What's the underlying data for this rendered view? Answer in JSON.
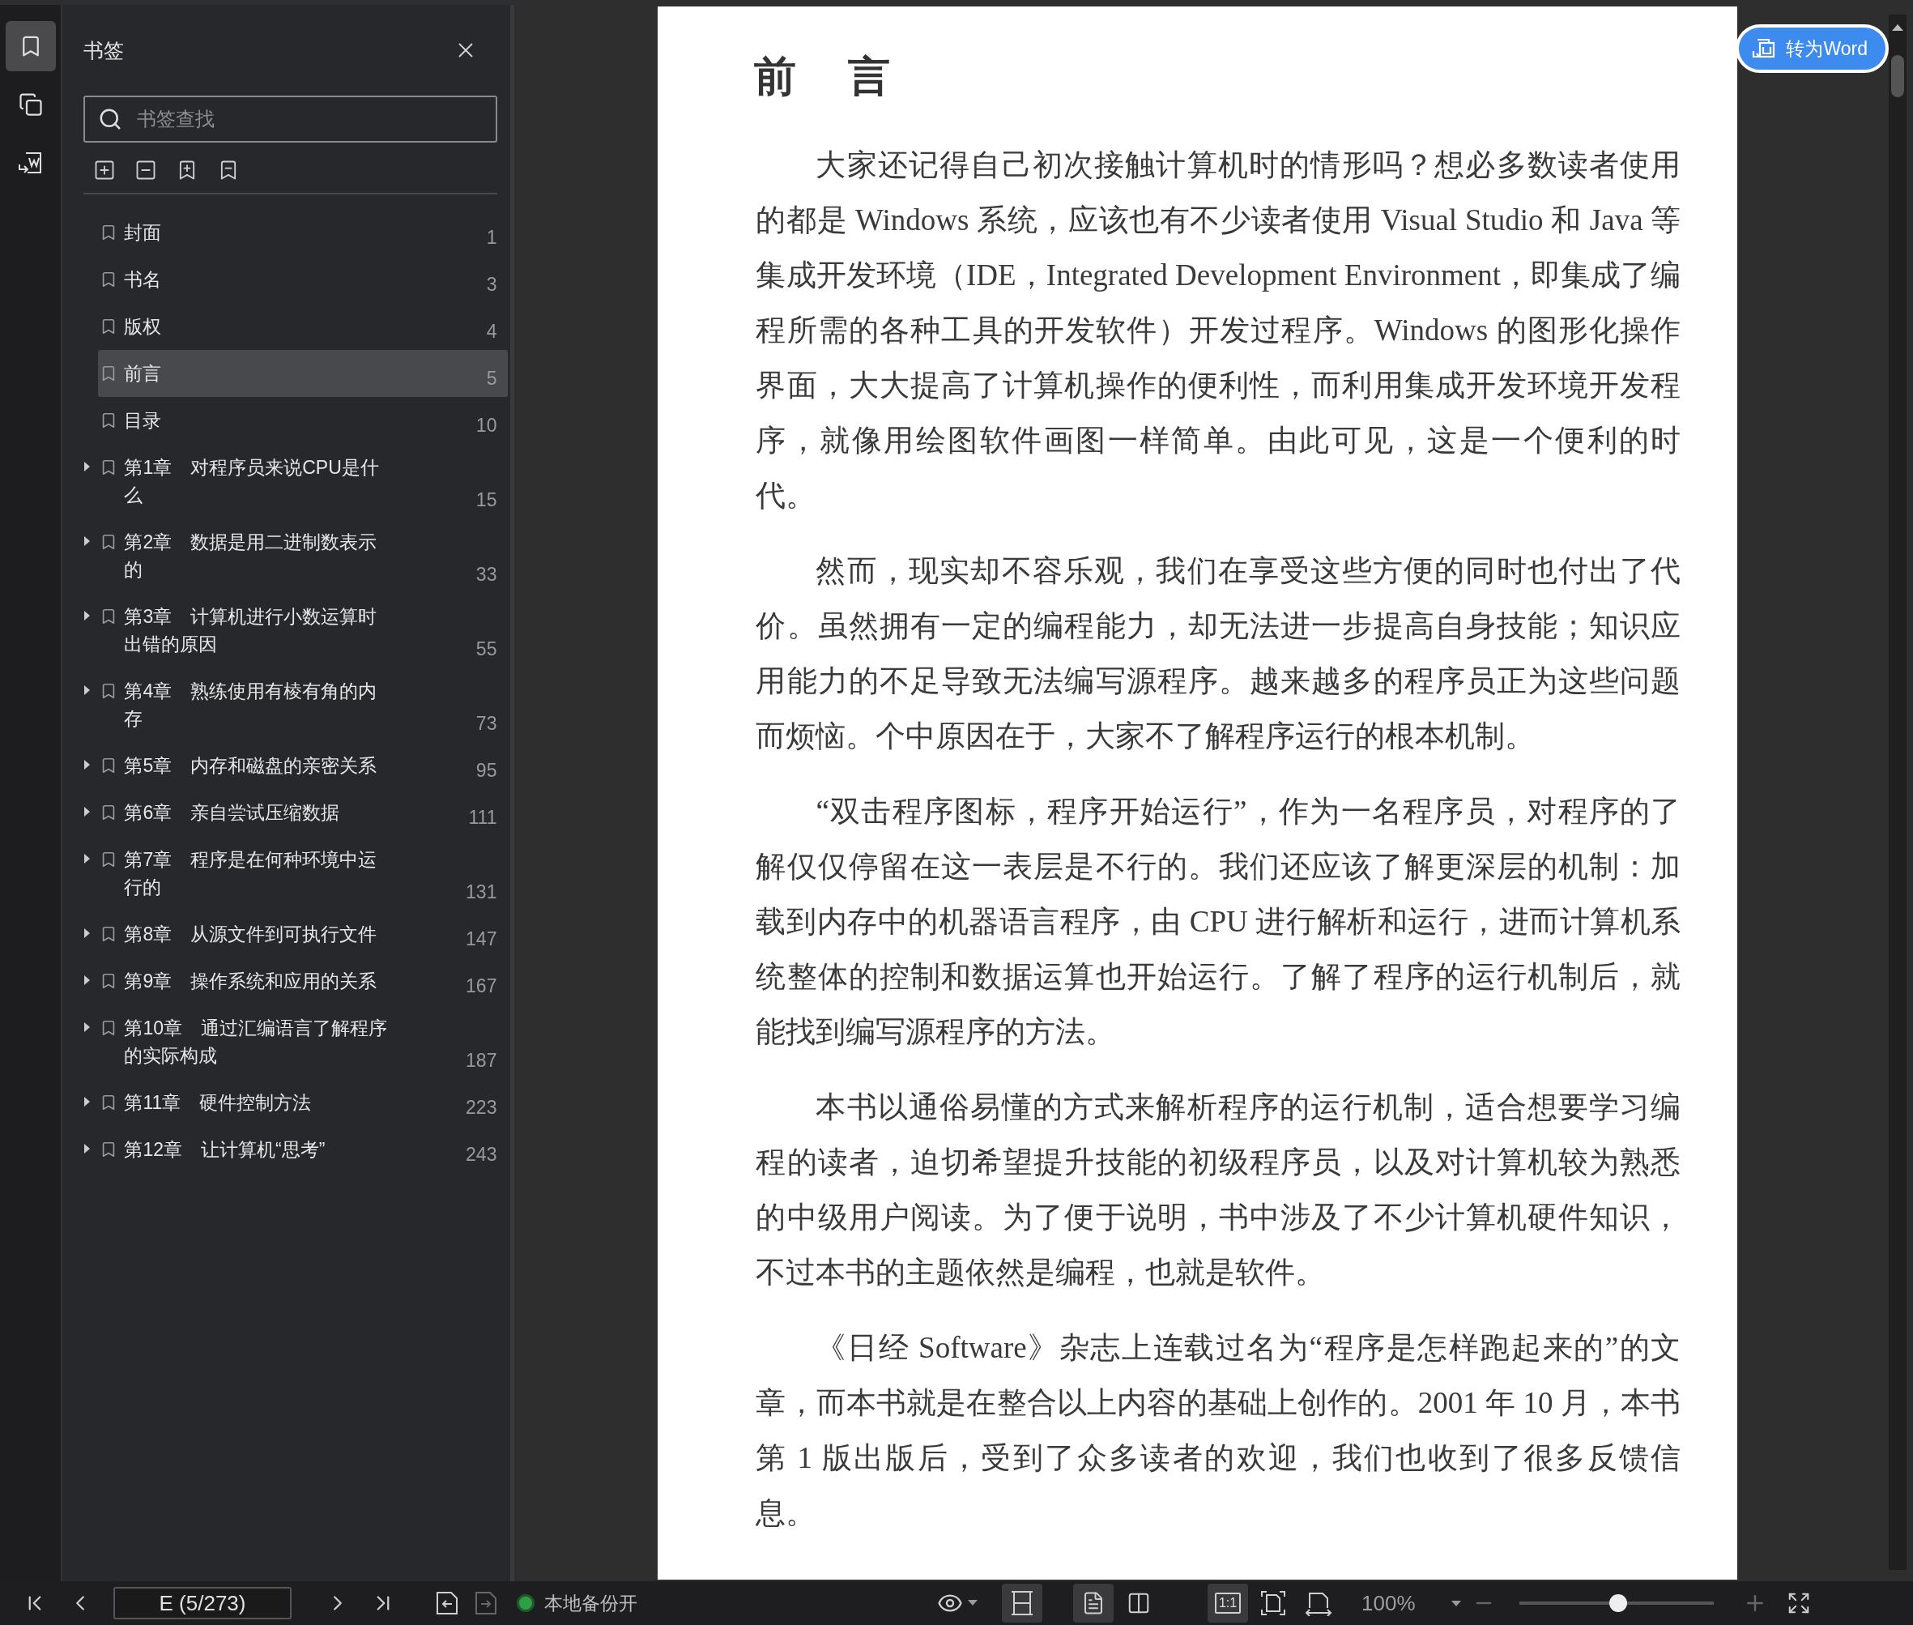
{
  "rail_tabs": [
    {
      "kind": "bookmark",
      "selected": true
    },
    {
      "kind": "pages",
      "selected": false
    },
    {
      "kind": "convert",
      "selected": false
    }
  ],
  "sidebar": {
    "title": "书签",
    "search": {
      "placeholder": "书签查找"
    },
    "bookmarks": [
      {
        "label": "封面",
        "page": "1",
        "selected": false
      },
      {
        "label": "书名",
        "page": "3",
        "selected": false
      },
      {
        "label": "版权",
        "page": "4",
        "selected": false
      },
      {
        "label": "前言",
        "page": "5",
        "selected": true
      },
      {
        "label": "目录",
        "page": "10",
        "selected": false
      },
      {
        "label": "第1章　对程序员来说CPU是什么",
        "page": "15",
        "selected": false,
        "expanded": false
      },
      {
        "label": "第2章　数据是用二进制数表示的",
        "page": "33",
        "selected": false,
        "expanded": false
      },
      {
        "label": "第3章　计算机进行小数运算时出错的原因",
        "page": "55",
        "selected": false,
        "expanded": false
      },
      {
        "label": "第4章　熟练使用有棱有角的内存",
        "page": "73",
        "selected": false,
        "expanded": false
      },
      {
        "label": "第5章　内存和磁盘的亲密关系",
        "page": "95",
        "selected": false,
        "expanded": false
      },
      {
        "label": "第6章　亲自尝试压缩数据",
        "page": "111",
        "selected": false,
        "expanded": false
      },
      {
        "label": "第7章　程序是在何种环境中运行的",
        "page": "131",
        "selected": false,
        "expanded": false
      },
      {
        "label": "第8章　从源文件到可执行文件",
        "page": "147",
        "selected": false,
        "expanded": false
      },
      {
        "label": "第9章　操作系统和应用的关系",
        "page": "167",
        "selected": false,
        "expanded": false
      },
      {
        "label": "第10章　通过汇编语言了解程序的实际构成",
        "page": "187",
        "selected": false,
        "expanded": false
      },
      {
        "label": "第11章　硬件控制方法",
        "page": "223",
        "selected": false,
        "expanded": false
      },
      {
        "label": "第12章　让计算机“思考”",
        "page": "243",
        "selected": false,
        "expanded": false
      }
    ]
  },
  "document": {
    "title": "前　言",
    "paragraphs": [
      "大家还记得自己初次接触计算机时的情形吗？想必多数读者使用的都是 Windows 系统，应该也有不少读者使用 Visual Studio 和 Java 等集成开发环境（IDE，Integrated Development Environment，即集成了编程所需的各种工具的开发软件）开发过程序。Windows 的图形化操作界面，大大提高了计算机操作的便利性，而利用集成开发环境开发程序，就像用绘图软件画图一样简单。由此可见，这是一个便利的时代。",
      "然而，现实却不容乐观，我们在享受这些方便的同时也付出了代价。虽然拥有一定的编程能力，却无法进一步提高自身技能；知识应用能力的不足导致无法编写源程序。越来越多的程序员正为这些问题而烦恼。个中原因在于，大家不了解程序运行的根本机制。",
      "“双击程序图标，程序开始运行”，作为一名程序员，对程序的了解仅仅停留在这一表层是不行的。我们还应该了解更深层的机制：加载到内存中的机器语言程序，由 CPU 进行解析和运行，进而计算机系统整体的控制和数据运算也开始运行。了解了程序的运行机制后，就能找到编写源程序的方法。",
      "本书以通俗易懂的方式来解析程序的运行机制，适合想要学习编程的读者，迫切希望提升技能的初级程序员，以及对计算机较为熟悉的中级用户阅读。为了便于说明，书中涉及了不少计算机硬件知识，不过本书的主题依然是编程，也就是软件。",
      "《日经 Software》杂志上连载过名为“程序是怎样跑起来的”的文章，而本书就是在整合以上内容的基础上创作的。2001 年 10 月，本书第 1 版出版后，受到了众多读者的欢迎，我们也收到了很多反馈信息。"
    ]
  },
  "convert_button": {
    "label": "转为Word"
  },
  "bottom_bar": {
    "page_field": {
      "value": "E (5/273)"
    },
    "history": [
      {
        "kind": "back",
        "disabled": false
      },
      {
        "kind": "forward",
        "disabled": true
      }
    ],
    "backup": {
      "label": "本地备份开",
      "on": true
    },
    "layout_buttons": [
      {
        "kind": "fit-width",
        "selected": true
      }
    ],
    "view_modes": [
      {
        "kind": "single",
        "selected": true
      },
      {
        "kind": "double",
        "selected": false
      }
    ],
    "zoom_modes": [
      {
        "kind": "actual",
        "label": "1:1",
        "selected": true
      },
      {
        "kind": "fit-page",
        "selected": false
      },
      {
        "kind": "rotate",
        "selected": false
      }
    ],
    "zoom": {
      "value": "100%",
      "level": 0.51
    }
  }
}
